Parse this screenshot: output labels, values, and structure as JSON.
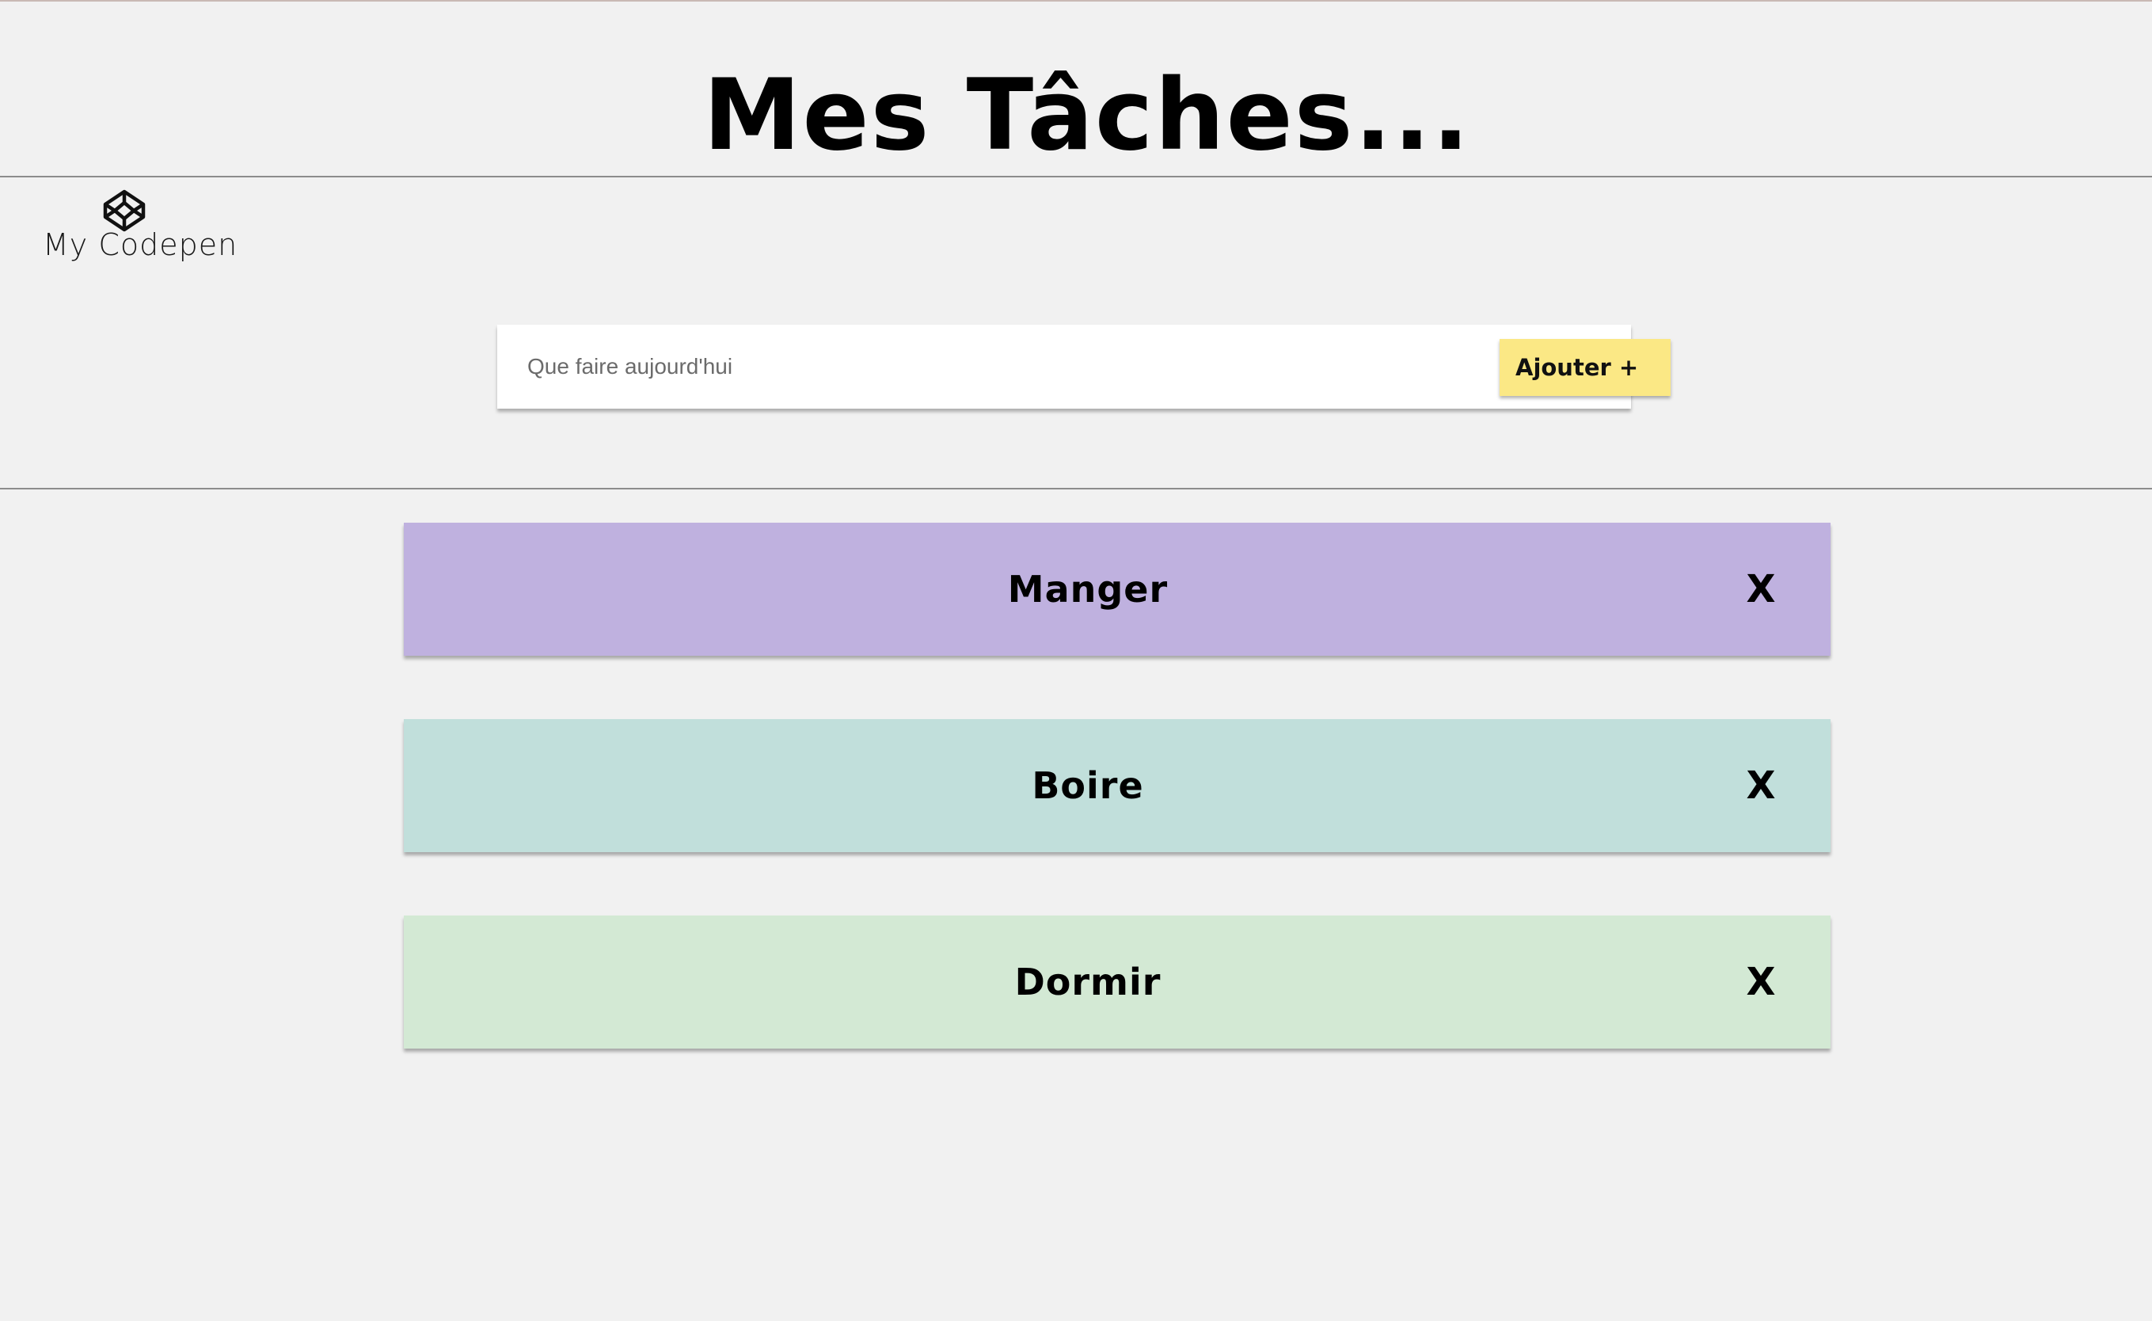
{
  "header": {
    "title": "Mes Tâches..."
  },
  "codepen": {
    "icon": "codepen-icon",
    "label": "My Codepen"
  },
  "form": {
    "input_placeholder": "Que faire aujourd'hui",
    "input_value": "",
    "add_label": "Ajouter +",
    "add_color": "#fbe885"
  },
  "tasks": [
    {
      "label": "Manger",
      "delete_label": "X",
      "color": "#bfb1df"
    },
    {
      "label": "Boire",
      "delete_label": "X",
      "color": "#c1dfdb"
    },
    {
      "label": "Dormir",
      "delete_label": "X",
      "color": "#d3e9d4"
    }
  ]
}
